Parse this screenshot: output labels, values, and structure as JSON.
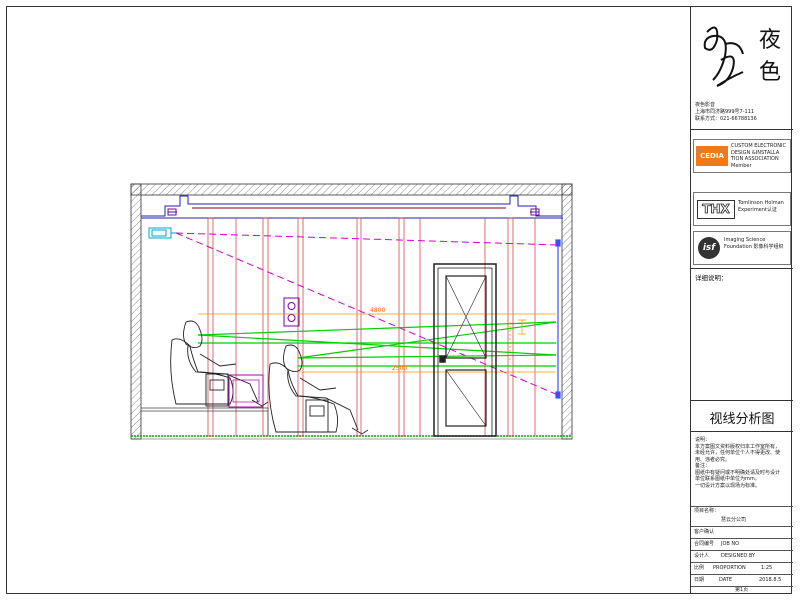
{
  "brand": {
    "name_zh": "夜色",
    "company": "夜色影音",
    "address": "上海市同济路999号7-111",
    "contact": "联系方式：021-66788136"
  },
  "associations": [
    {
      "logo": "CEDIA",
      "text": "CUSTOM ELECTRONIC DESIGN &INSTALLA TION ASSOCIATION Member"
    },
    {
      "logo": "THX",
      "text": "Tomlinson Holman Experiment认证"
    },
    {
      "logo": "isf",
      "text": "Imaging Science Foundation 影像科学组织"
    }
  ],
  "details_label": "详细说明：",
  "drawing_title": "视线分析图",
  "notes": [
    "说明：",
    "本方案图文资料版权归本工作室所有，",
    "未经允许，任何单位个人不得更改、使",
    "用、违者必究。",
    "备注：",
    "图纸中有疑问或不明确处请及时与设计",
    "单位联系图纸中单位为mm。",
    "一切设计方案以现场为标准。"
  ],
  "project_label": "项目名称：",
  "project_value": "慧云分公司",
  "client_label": "客户确认",
  "rows": [
    {
      "zh": "合同编号",
      "en": "JOB NO",
      "value": ""
    },
    {
      "zh": "设计人",
      "en": "DESIGNED BY",
      "value": ""
    },
    {
      "zh": "比例",
      "en": "PROPORTION",
      "value": "1:25"
    },
    {
      "zh": "日期",
      "en": "DATE",
      "value": "2018.8.5"
    }
  ],
  "page": "第1页",
  "dimensions": {
    "upper": "4800",
    "lower": "2500"
  },
  "colors": {
    "magenta": "#d000d0",
    "green": "#00cc00",
    "orange": "#ff9900",
    "red": "#cc0000",
    "blue": "#3333cc",
    "cyan": "#00a0d0"
  }
}
